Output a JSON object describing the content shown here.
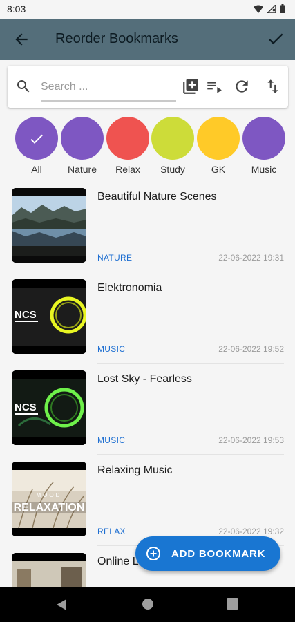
{
  "status_bar": {
    "time": "8:03"
  },
  "app_bar": {
    "title": "Reorder Bookmarks"
  },
  "search": {
    "placeholder": "Search ..."
  },
  "categories": [
    {
      "label": "All",
      "color": "#7e57c2",
      "selected": true
    },
    {
      "label": "Nature",
      "color": "#7e57c2"
    },
    {
      "label": "Relax",
      "color": "#ef5350"
    },
    {
      "label": "Study",
      "color": "#cddc39"
    },
    {
      "label": "GK",
      "color": "#ffca28"
    },
    {
      "label": "Music",
      "color": "#7e57c2"
    }
  ],
  "bookmarks": [
    {
      "title": "Beautiful Nature Scenes",
      "category": "NATURE",
      "date": "22-06-2022 19:31"
    },
    {
      "title": "Elektronomia",
      "category": "MUSIC",
      "date": "22-06-2022 19:52"
    },
    {
      "title": "Lost Sky - Fearless",
      "category": "MUSIC",
      "date": "22-06-2022 19:53"
    },
    {
      "title": "Relaxing Music",
      "category": "RELAX",
      "date": "22-06-2022 19:32"
    },
    {
      "title": "Online L",
      "category": "",
      "date": ""
    }
  ],
  "thumb_text": {
    "ncs": "NCS",
    "mood": "MOOD",
    "relaxation": "RELAXATION"
  },
  "fab": {
    "label": "ADD BOOKMARK"
  },
  "colors": {
    "app_bar": "#546e7a",
    "accent": "#1976d2",
    "category_text": "#1e6fd1"
  }
}
